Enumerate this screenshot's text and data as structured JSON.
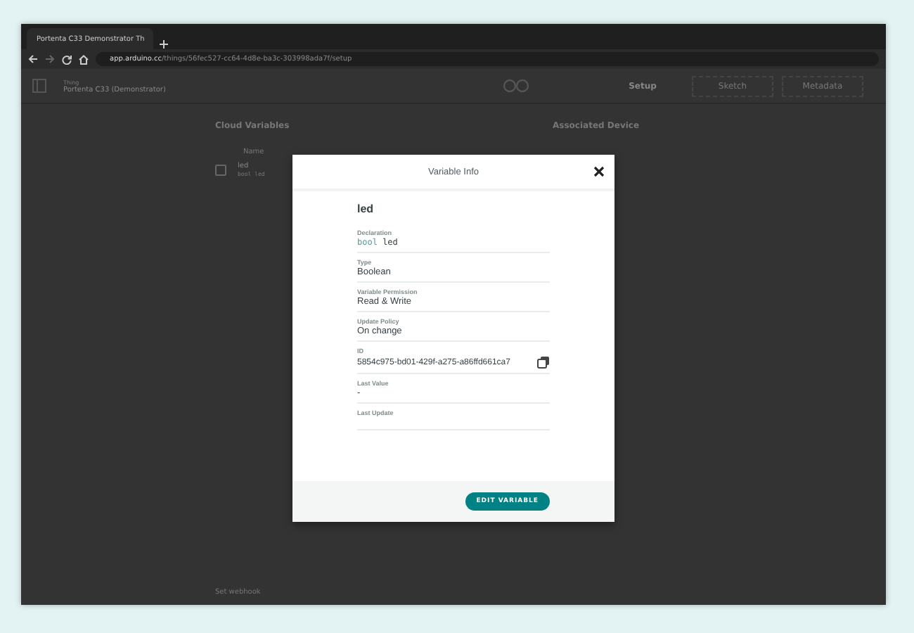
{
  "browser": {
    "tab_title": "Portenta C33 Demonstrator Th",
    "url_host": "app.arduino.cc",
    "url_path": "/things/56fec527-cc64-4d8e-ba3c-303998ada7f/setup"
  },
  "app_header": {
    "thing_label": "Thing",
    "thing_name": "Portenta C33 (Demonstrator)",
    "tabs": [
      {
        "label": "Setup",
        "selected": true
      },
      {
        "label": "Sketch",
        "selected": false
      },
      {
        "label": "Metadata",
        "selected": false
      }
    ]
  },
  "cloud_variables": {
    "title": "Cloud Variables",
    "column": "Name",
    "rows": [
      {
        "name": "led",
        "declaration": "bool led",
        "checked": false
      }
    ]
  },
  "associated_device": {
    "title": "Associated Device"
  },
  "webhook": {
    "label": "Set webhook"
  },
  "dialog": {
    "title": "Variable Info",
    "variable_name": "led",
    "fields": [
      {
        "label": "Declaration",
        "kind": "code",
        "type_part": "bool",
        "name_part": "led"
      },
      {
        "label": "Type",
        "kind": "text",
        "value": "Boolean"
      },
      {
        "label": "Variable Permission",
        "kind": "text",
        "value": "Read & Write"
      },
      {
        "label": "Update Policy",
        "kind": "text",
        "value": "On change"
      },
      {
        "label": "ID",
        "kind": "copy",
        "value": "5854c975-bd01-429f-a275-a86ffd661ca7"
      },
      {
        "label": "Last Value",
        "kind": "text",
        "value": "-"
      },
      {
        "label": "Last Update",
        "kind": "empty"
      }
    ],
    "button": "EDIT VARIABLE"
  }
}
